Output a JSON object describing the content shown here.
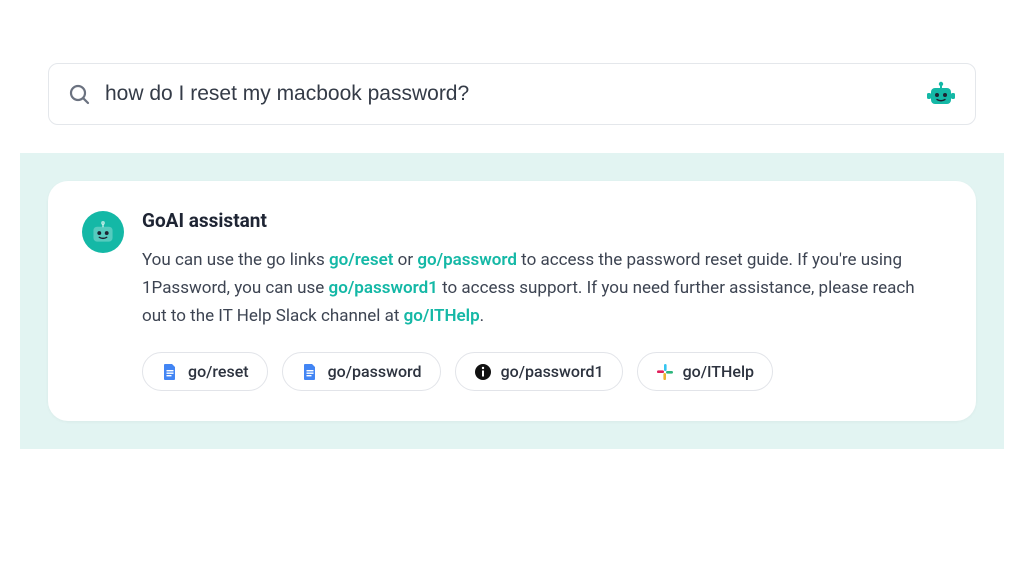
{
  "search": {
    "query": "how do I reset my macbook password?"
  },
  "assistant": {
    "title": "GoAI assistant",
    "response_parts": [
      {
        "type": "text",
        "value": "You can use the go links "
      },
      {
        "type": "link",
        "value": "go/reset"
      },
      {
        "type": "text",
        "value": " or "
      },
      {
        "type": "link",
        "value": "go/password"
      },
      {
        "type": "text",
        "value": " to access the password reset guide. If you're using 1Password, you can use "
      },
      {
        "type": "link",
        "value": "go/password1"
      },
      {
        "type": "text",
        "value": " to access support. If you need further assistance, please reach out to the IT Help Slack channel at "
      },
      {
        "type": "link",
        "value": "go/ITHelp"
      },
      {
        "type": "text",
        "value": "."
      }
    ]
  },
  "chips": [
    {
      "icon": "doc-icon",
      "label": "go/reset",
      "color": "#4285f4"
    },
    {
      "icon": "doc-icon",
      "label": "go/password",
      "color": "#4285f4"
    },
    {
      "icon": "info-icon",
      "label": "go/password1",
      "color": "#111111"
    },
    {
      "icon": "slack-icon",
      "label": "go/ITHelp",
      "color": "multi"
    }
  ],
  "colors": {
    "accent": "#14b8a6",
    "response_bg": "#e2f4f2"
  }
}
